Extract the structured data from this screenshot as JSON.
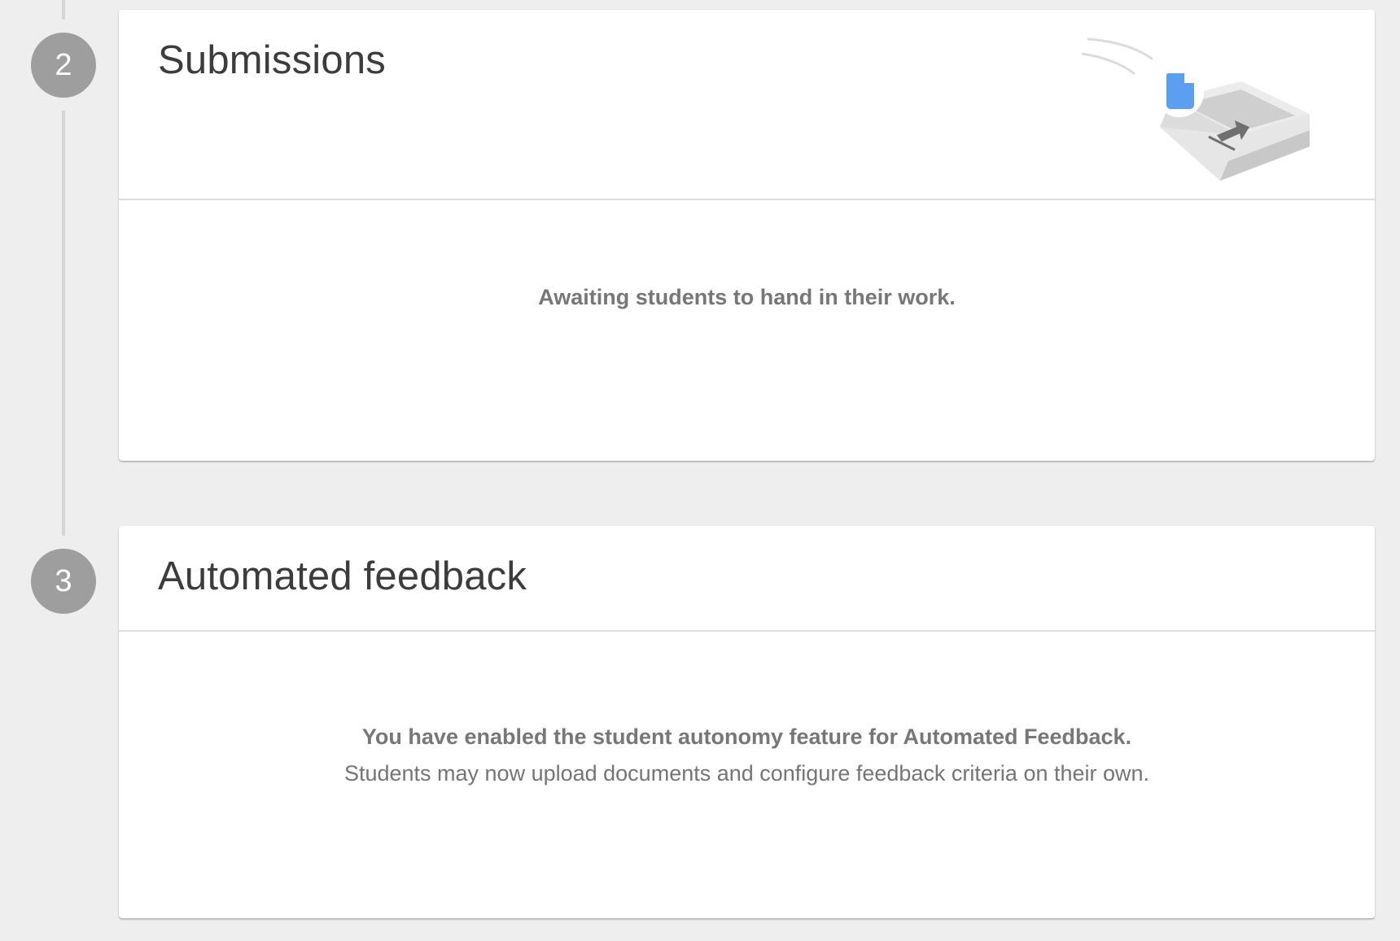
{
  "steps": [
    {
      "number": "2",
      "title": "Submissions",
      "message": "Awaiting students to hand in their work."
    },
    {
      "number": "3",
      "title": "Automated feedback",
      "message_bold": "You have enabled the student autonomy feature for Automated Feedback.",
      "message_detail": "Students may now upload documents and configure feedback criteria on their own."
    }
  ],
  "icons": {
    "illustration": "submission-tray-icon",
    "document": "document-icon"
  },
  "colors": {
    "background": "#eeeeee",
    "step_circle": "#9e9e9e",
    "document_blue": "#5b9ff0"
  }
}
